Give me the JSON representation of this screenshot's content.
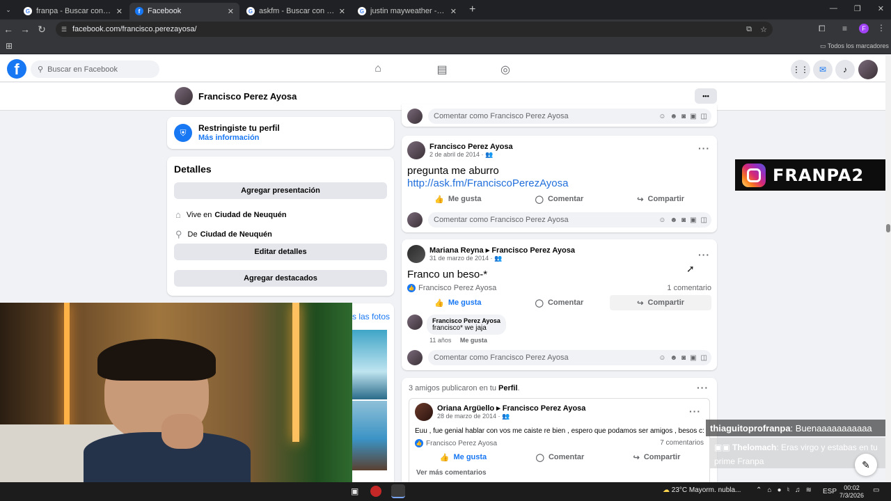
{
  "browser": {
    "tabs": [
      {
        "title": "franpa - Buscar con Google",
        "icon": "google-icon",
        "active": false
      },
      {
        "title": "Facebook",
        "icon": "facebook-icon",
        "active": true
      },
      {
        "title": "askfm - Buscar con Google",
        "icon": "google-icon",
        "active": false
      },
      {
        "title": "justin mayweather - Buscar con",
        "icon": "google-icon",
        "active": false
      }
    ],
    "new_tab": "+",
    "url": "facebook.com/francisco.perezayosa/",
    "bookmarks_all": "Todos los marcadores",
    "profile_initial": "F"
  },
  "fb": {
    "search_placeholder": "Buscar en Facebook",
    "profile_name": "Francisco Perez Ayosa",
    "more_dots": "•••"
  },
  "restricted": {
    "title": "Restringiste tu perfil",
    "link": "Más información"
  },
  "details": {
    "heading": "Detalles",
    "add_presentation": "Agregar presentación",
    "lives_prefix": "Vive en",
    "lives_city": "Ciudad de Neuquén",
    "from_prefix": "De",
    "from_city": "Ciudad de Neuquén",
    "edit_details": "Editar detalles",
    "add_featured": "Agregar destacados"
  },
  "photos_link": "s las fotos",
  "comment_placeholder": "Comentar como Francisco Perez Ayosa",
  "actions": {
    "like": "Me gusta",
    "comment": "Comentar",
    "share": "Compartir"
  },
  "post1": {
    "author": "Francisco Perez Ayosa",
    "date": "2 de abril de 2014 ·",
    "text": "pregunta me aburro",
    "link": "http://ask.fm/FranciscoPerezAyosa"
  },
  "post2": {
    "author": "Mariana Reyna",
    "target": "Francisco Perez Ayosa",
    "date": "31 de marzo de 2014 ·",
    "text": "Franco un beso-*",
    "liker": "Francisco Perez Ayosa",
    "comment_count": "1 comentario",
    "reply": {
      "author": "Francisco Perez Ayosa",
      "text": "francisco* we jaja",
      "age": "11 años",
      "like": "Me gusta"
    }
  },
  "friends_post": {
    "header_prefix": "3 amigos publicaron en tu",
    "header_link": "Perfil",
    "header_suffix": ".",
    "author": "Oriana Argüello",
    "target": "Francisco Perez Ayosa",
    "date": "28 de marzo de 2014 ·",
    "text": "Euu , fue genial hablar con vos   me caiste re bien , espero que podamos ser amigos , besos c:",
    "liker": "Francisco Perez Ayosa",
    "comment_count": "7 comentarios",
    "more_comments": "Ver más comentarios"
  },
  "overlay": {
    "ig_handle": "FRANPA2",
    "chat1_user": "thiaguitoprofranpa",
    "chat1_msg": ": Buenaaaaaaaaaaa",
    "chat2_user": "Thelomach",
    "chat2_msg": ": Eras virgo y estabas en tu prime Franpa"
  },
  "taskbar": {
    "weather": "23°C  Mayorm. nubla...",
    "lang": "ESP",
    "time": "00:02",
    "date": "7/3/2026"
  },
  "colors": {
    "fb_blue": "#1877f2",
    "chrome_dark": "#202124"
  }
}
